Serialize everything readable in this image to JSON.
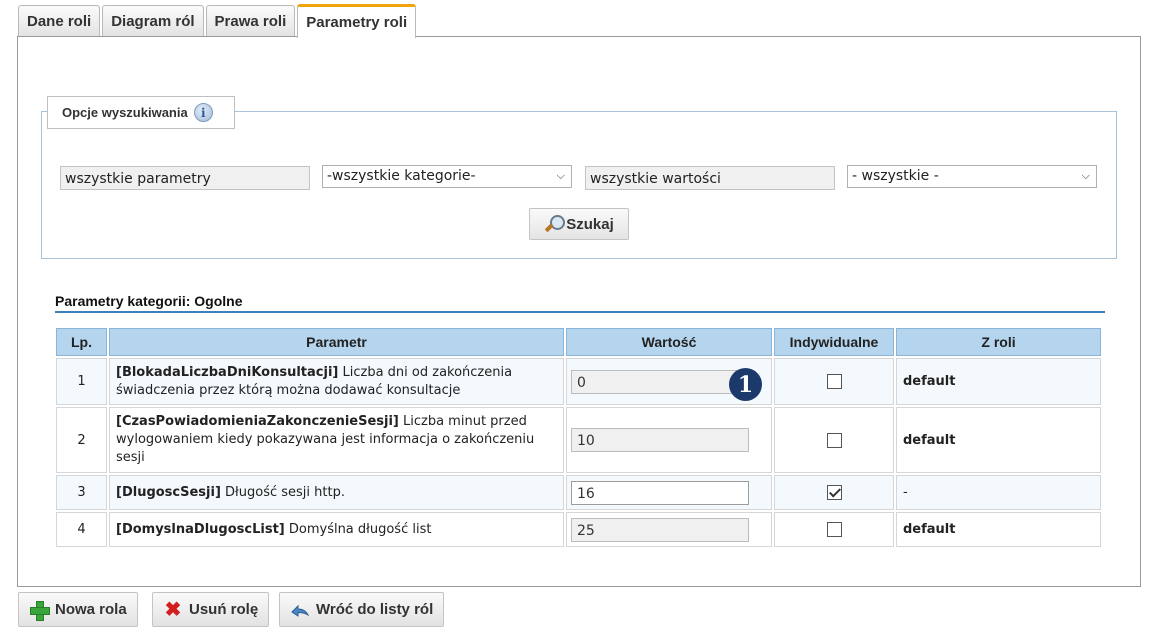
{
  "tabs": [
    {
      "label": "Dane roli",
      "active": false
    },
    {
      "label": "Diagram ról",
      "active": false
    },
    {
      "label": "Prawa roli",
      "active": false
    },
    {
      "label": "Parametry roli",
      "active": true
    }
  ],
  "search": {
    "legend": "Opcje wyszukiwania",
    "name_filter": "wszystkie parametry",
    "category_select": "-wszystkie kategorie-",
    "value_filter": "wszystkie wartości",
    "scope_select": "- wszystkie -",
    "search_button": "Szukaj"
  },
  "category": {
    "title": "Parametry kategorii: Ogolne"
  },
  "table": {
    "headers": [
      "Lp.",
      "Parametr",
      "Wartość",
      "Indywidualne",
      "Z roli"
    ],
    "rows": [
      {
        "lp": "1",
        "name": "[BlokadaLiczbaDniKonsultacji]",
        "desc": " Liczba dni od zakończenia świadczenia przez którą można dodawać konsultacje",
        "value": "0",
        "individual": false,
        "from_role": "default"
      },
      {
        "lp": "2",
        "name": "[CzasPowiadomieniaZakonczenieSesji]",
        "desc": " Liczba minut przed wylogowaniem kiedy pokazywana jest informacja o zakończeniu sesji",
        "value": "10",
        "individual": false,
        "from_role": "default"
      },
      {
        "lp": "3",
        "name": "[DlugoscSesji]",
        "desc": " Długość sesji http.",
        "value": "16",
        "individual": true,
        "from_role": "-"
      },
      {
        "lp": "4",
        "name": "[DomyslnaDlugoscList]",
        "desc": " Domyślna długość list",
        "value": "25",
        "individual": false,
        "from_role": "default"
      }
    ]
  },
  "marker": "1",
  "buttons": {
    "new_role": "Nowa rola",
    "delete_role": "Usuń rolę",
    "back": "Wróć do listy ról"
  },
  "icons": {
    "info": "info-icon",
    "search": "magnifier-icon",
    "new": "plus-icon",
    "delete": "x-icon",
    "back": "back-arrow-icon"
  },
  "colors": {
    "tab_accent": "#f0a30a",
    "header_bg": "#b5d4ed",
    "category_line": "#3d7fc0",
    "marker_bg": "#1b3a6b"
  }
}
